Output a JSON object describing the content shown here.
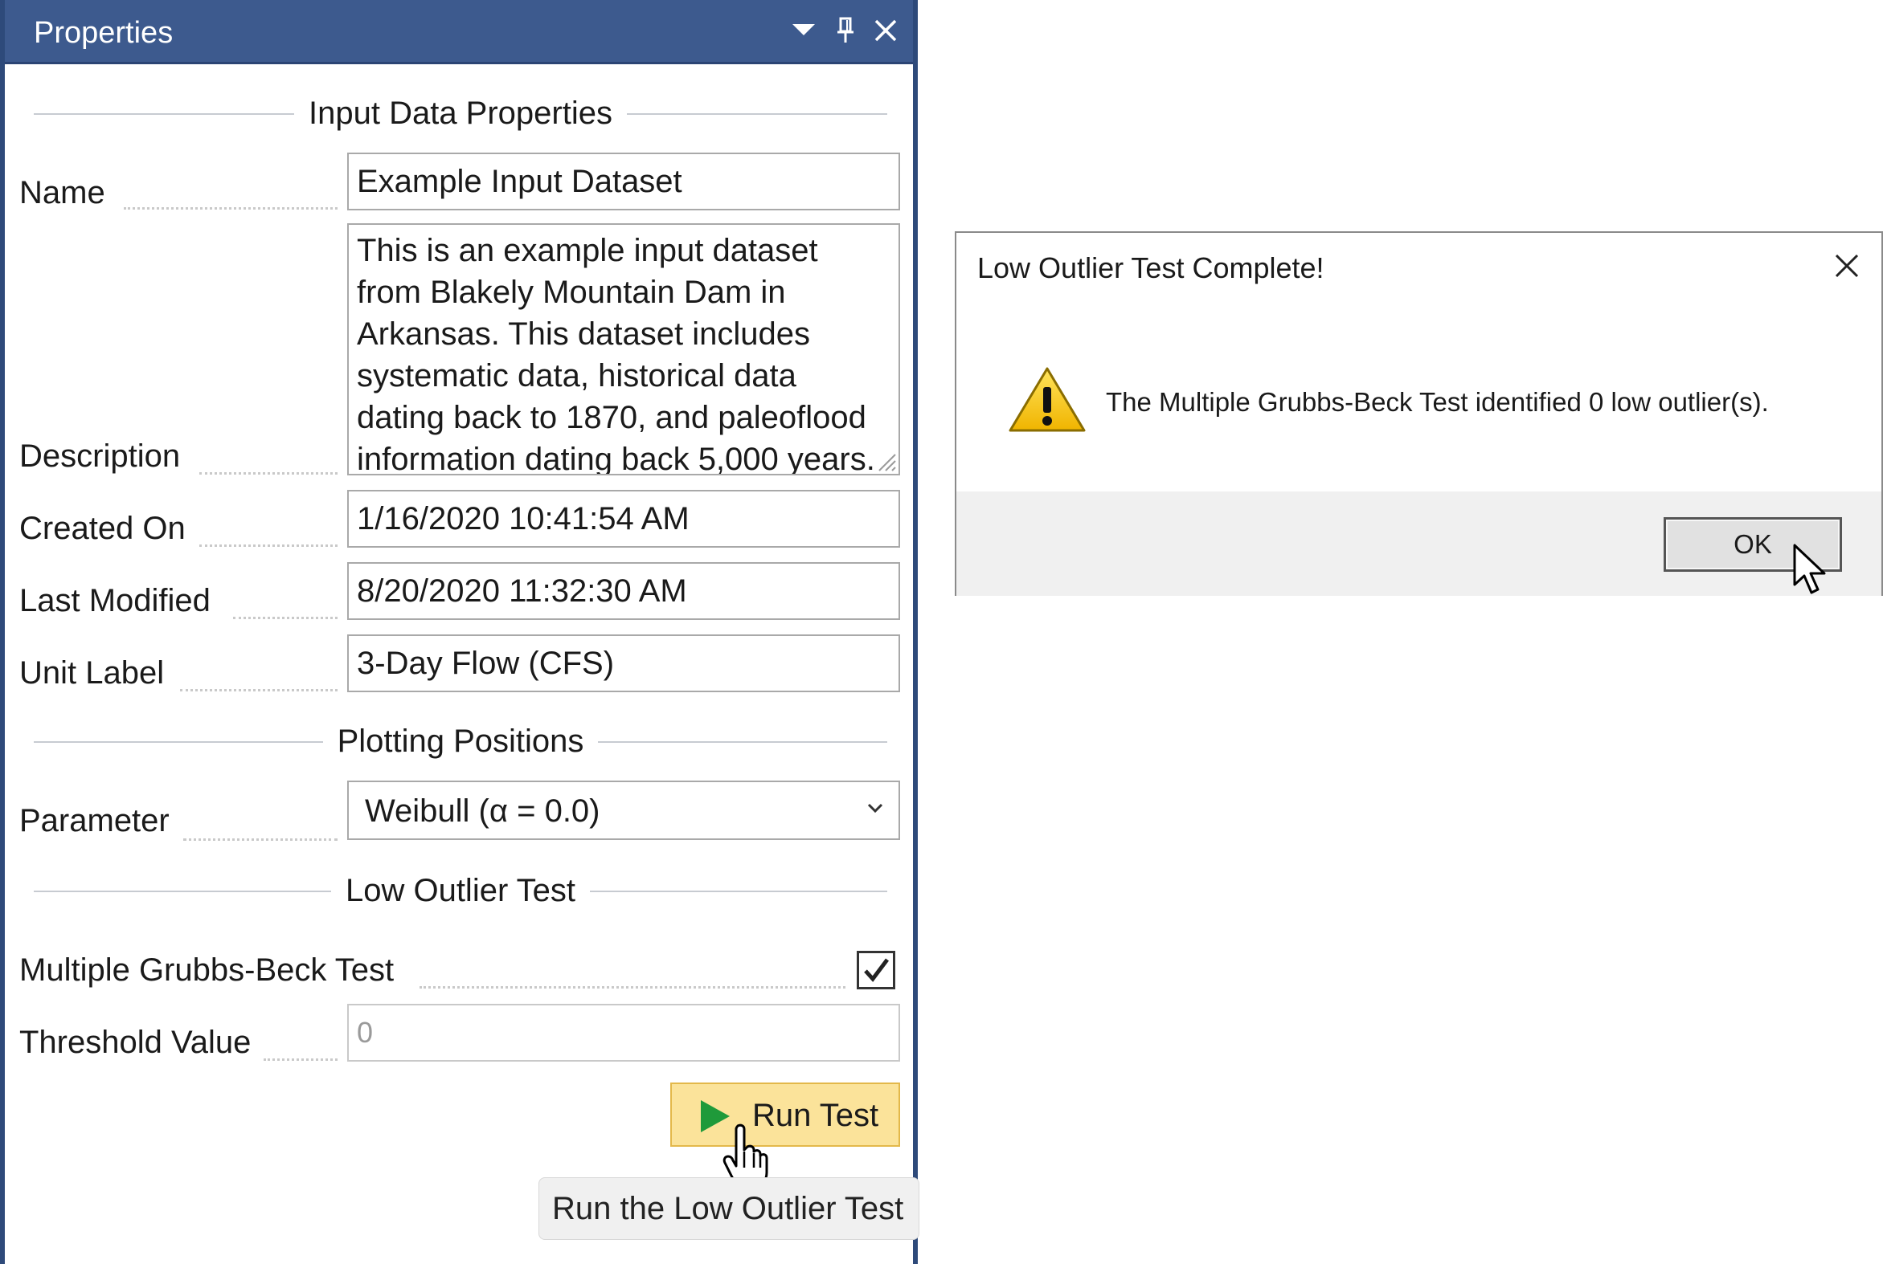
{
  "properties_panel": {
    "title": "Properties",
    "icons": [
      "dropdown-icon",
      "pin-icon",
      "close-icon"
    ],
    "sections": {
      "input_data": "Input Data Properties",
      "plotting": "Plotting Positions",
      "low_outlier": "Low Outlier Test"
    },
    "fields": {
      "name": {
        "label": "Name",
        "value": "Example Input Dataset"
      },
      "description": {
        "label": "Description",
        "lines": [
          "This is an example input dataset",
          "from Blakely Mountain Dam in",
          "Arkansas. This dataset includes",
          "systematic data, historical data",
          "dating back to 1870, and paleoflood",
          "information dating back 5,000 years."
        ]
      },
      "created_on": {
        "label": "Created On",
        "value": "1/16/2020 10:41:54 AM"
      },
      "last_modified": {
        "label": "Last Modified",
        "value": "8/20/2020 11:32:30 AM"
      },
      "unit_label": {
        "label": "Unit Label",
        "value": "3-Day Flow (CFS)"
      },
      "parameter": {
        "label": "Parameter",
        "value": "Weibull (α = 0.0)"
      },
      "mgbt": {
        "label": "Multiple Grubbs-Beck Test",
        "checked": true
      },
      "threshold": {
        "label": "Threshold Value",
        "placeholder": "0"
      }
    },
    "run_button": {
      "label": "Run Test"
    },
    "tooltip": "Run the Low Outlier Test"
  },
  "dialog": {
    "title": "Low Outlier Test Complete!",
    "message": "The Multiple Grubbs-Beck Test identified 0 low outlier(s).",
    "ok_label": "OK",
    "icons": [
      "warning-icon",
      "close-icon"
    ]
  },
  "colors": {
    "titlebar": "#3d5a8e",
    "panel_border": "#2e4a7a",
    "run_button_bg": "#fbe39a",
    "play_green": "#1f9a3a"
  }
}
